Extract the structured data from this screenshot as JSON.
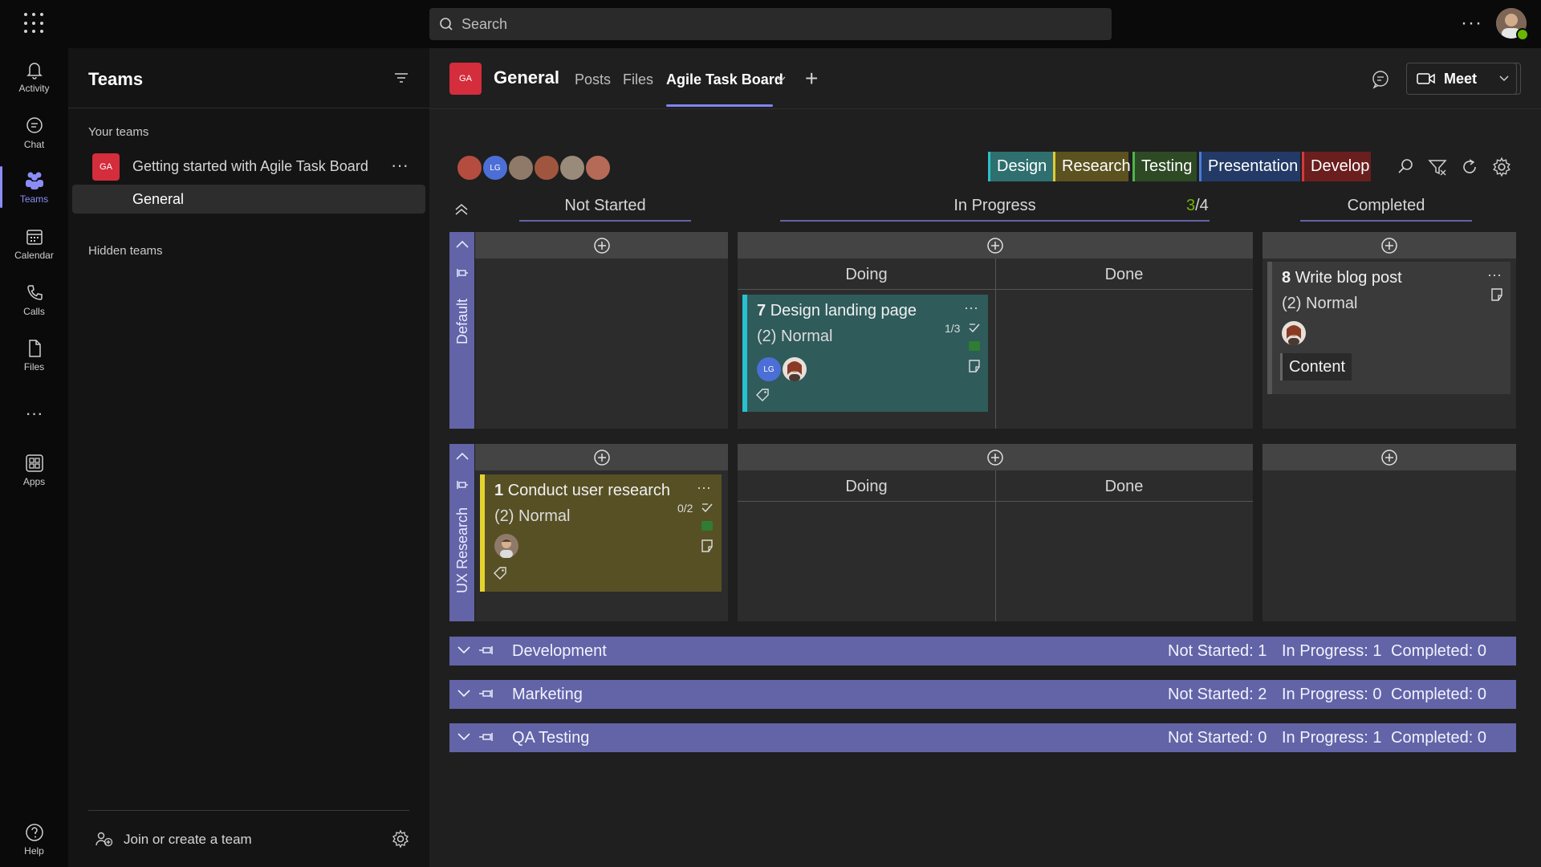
{
  "search": {
    "placeholder": "Search"
  },
  "rail": {
    "items": [
      {
        "label": "Activity",
        "icon": "bell-icon"
      },
      {
        "label": "Chat",
        "icon": "chat-icon"
      },
      {
        "label": "Teams",
        "icon": "teams-icon",
        "active": true
      },
      {
        "label": "Calendar",
        "icon": "calendar-icon"
      },
      {
        "label": "Calls",
        "icon": "phone-icon"
      },
      {
        "label": "Files",
        "icon": "file-icon"
      },
      {
        "label": "Apps",
        "icon": "apps-icon"
      }
    ],
    "help_label": "Help"
  },
  "teams_panel": {
    "title": "Teams",
    "your_teams_label": "Your teams",
    "team": {
      "initials": "GA",
      "name": "Getting started with Agile Task Board"
    },
    "channel": "General",
    "hidden_teams_label": "Hidden teams",
    "join_label": "Join or create a team"
  },
  "channel_header": {
    "initials": "GA",
    "name": "General",
    "tabs": [
      "Posts",
      "Files",
      "Agile Task Board"
    ],
    "active_tab": "Agile Task Board",
    "meet_label": "Meet"
  },
  "board": {
    "members": [
      {
        "initials": "",
        "color": "#b44d3f"
      },
      {
        "initials": "LG",
        "color": "#4b6fd6"
      },
      {
        "initials": "",
        "color": "#8f7a6a"
      },
      {
        "initials": "",
        "color": "#a0563e"
      },
      {
        "initials": "",
        "color": "#9a8a7a"
      },
      {
        "initials": "",
        "color": "#b56a58"
      }
    ],
    "tags": [
      {
        "label": "Design",
        "color": "#2f6f6f",
        "bar": "#2bc0c8"
      },
      {
        "label": "Research",
        "color": "#5b5220",
        "bar": "#e2cc32"
      },
      {
        "label": "Testing",
        "color": "#2e4a25",
        "bar": "#4fb44b"
      },
      {
        "label": "Presentation",
        "color": "#233a66",
        "bar": "#4a7ad9"
      },
      {
        "label": "Develop",
        "color": "#6a1e1e",
        "bar": "#d33a3a"
      }
    ],
    "columns": {
      "not_started": "Not Started",
      "in_progress": "In Progress",
      "in_progress_wip_current": "3",
      "in_progress_wip_limit": "/4",
      "completed": "Completed",
      "doing": "Doing",
      "done": "Done"
    },
    "lanes": [
      {
        "name": "Default",
        "cards": {
          "doing": {
            "number": "7",
            "title": "Design landing page",
            "priority": "(2) Normal",
            "checklist": "1/3",
            "assignee_initials": "LG",
            "color": "#2f5b5b",
            "accent": "#28c1cf"
          },
          "completed": {
            "number": "8",
            "title": "Write blog post",
            "priority": "(2) Normal",
            "label": "Content",
            "color": "#3a3a3a",
            "accent": "#555555"
          }
        }
      },
      {
        "name": "UX Research",
        "cards": {
          "not_started": {
            "number": "1",
            "title": "Conduct user research",
            "priority": "(2) Normal",
            "checklist": "0/2",
            "color": "#575024",
            "accent": "#e5d22e"
          }
        }
      }
    ],
    "collapsed_lanes": [
      {
        "name": "Development",
        "not_started": "Not Started: 1",
        "in_progress": "In Progress: 1",
        "completed": "Completed: 0"
      },
      {
        "name": "Marketing",
        "not_started": "Not Started: 2",
        "in_progress": "In Progress: 0",
        "completed": "Completed: 0"
      },
      {
        "name": "QA Testing",
        "not_started": "Not Started: 0",
        "in_progress": "In Progress: 1",
        "completed": "Completed: 0"
      }
    ]
  },
  "colors": {
    "accent": "#6264a7",
    "tab_active": "#7f85f5",
    "team_red": "#d42d3c",
    "wip_green": "#6bb700"
  }
}
